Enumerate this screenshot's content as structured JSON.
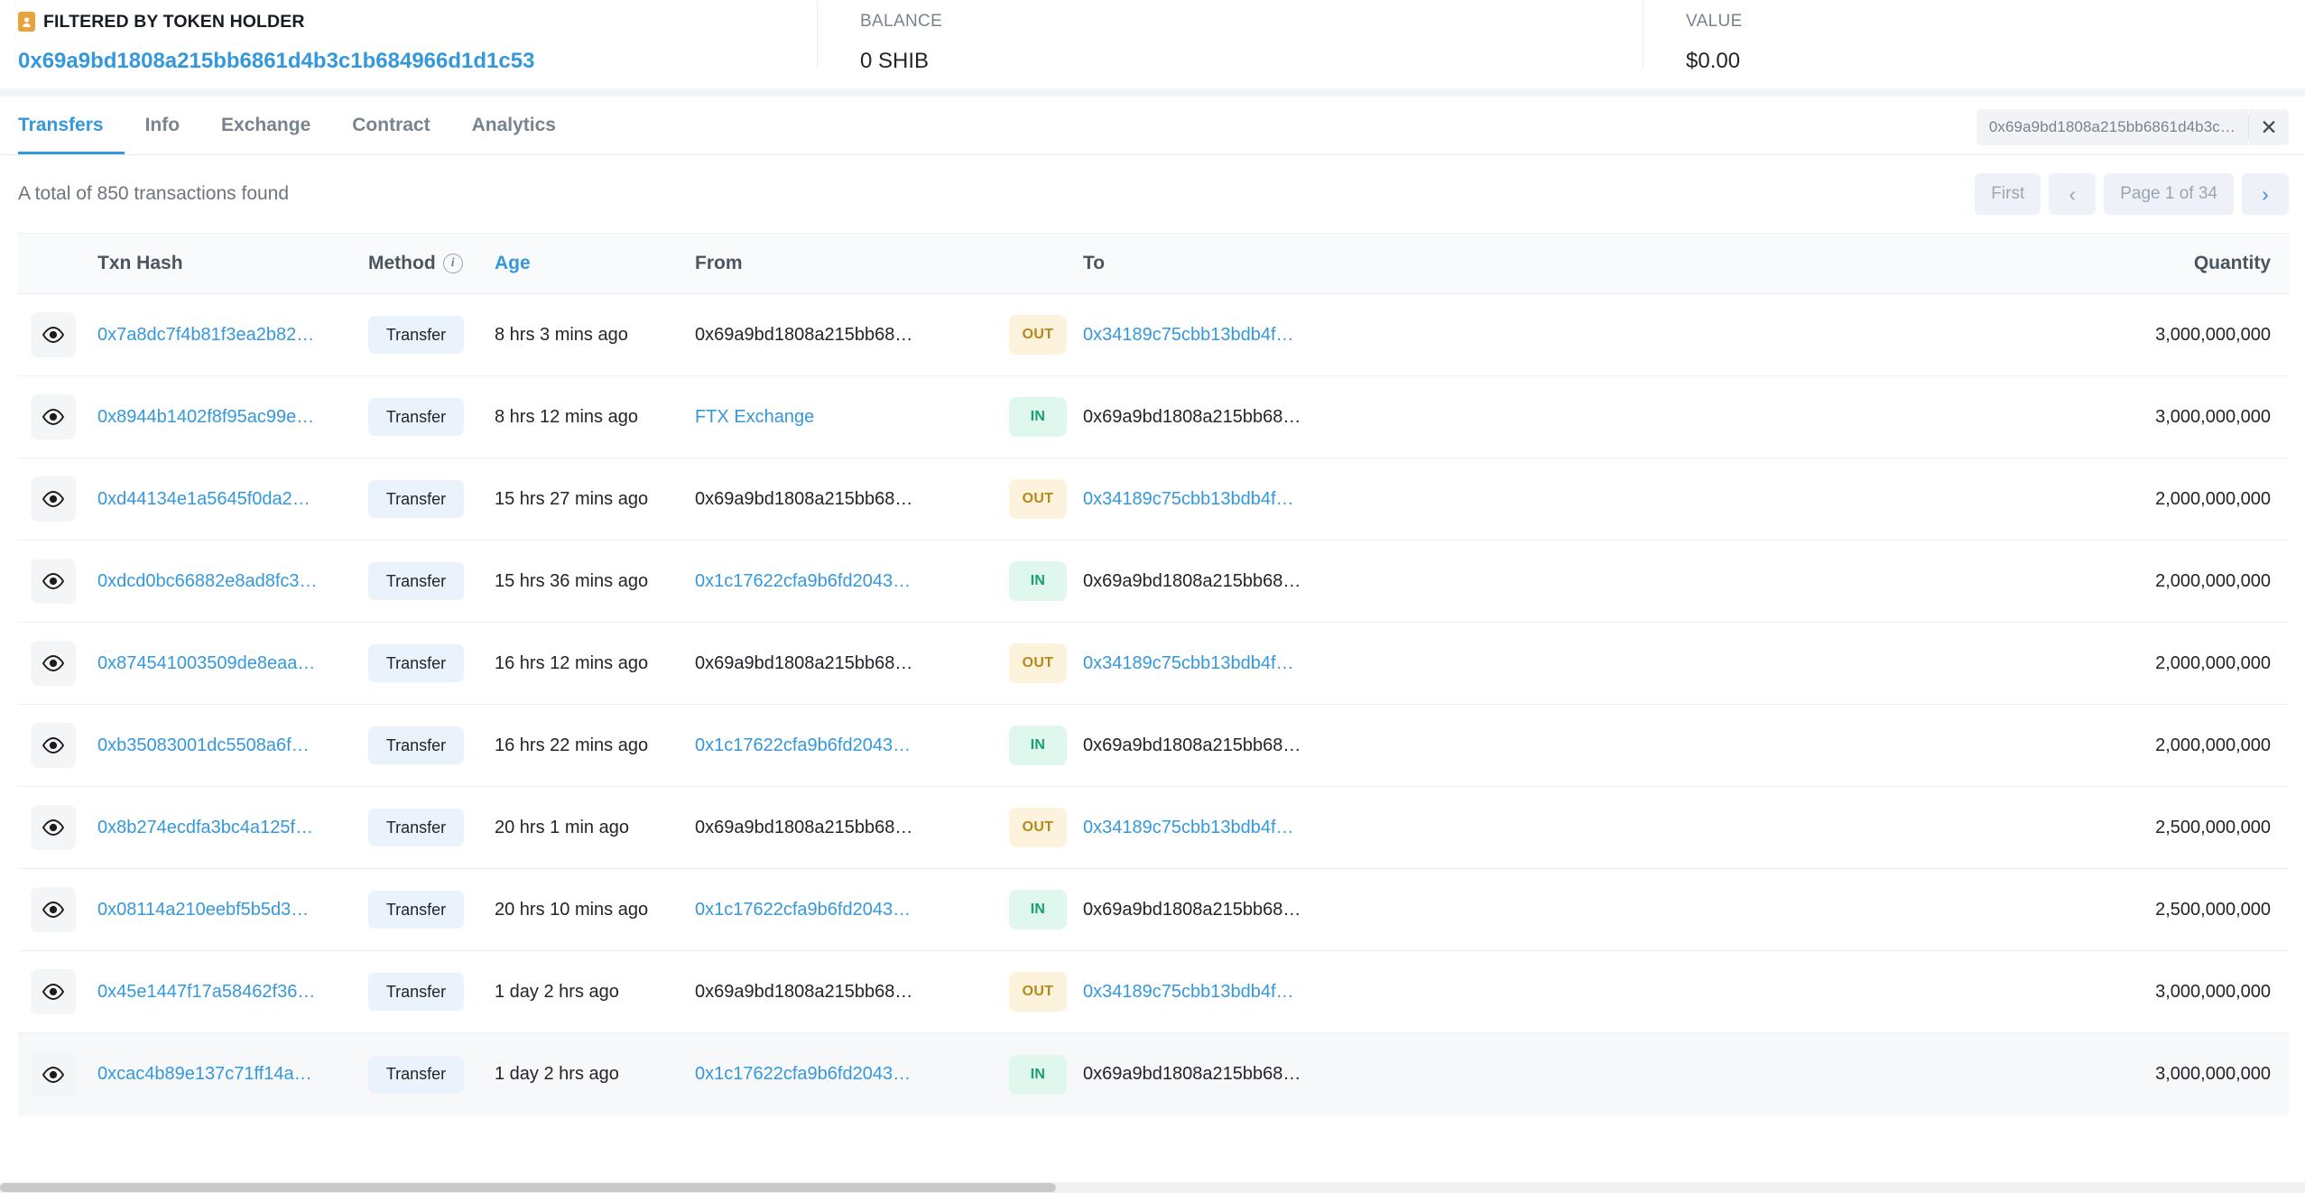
{
  "summary": {
    "filtered_label": "FILTERED BY TOKEN HOLDER",
    "filtered_icon": "token-holder-icon",
    "holder_address": "0x69a9bd1808a215bb6861d4b3c1b684966d1d1c53",
    "balance_label": "BALANCE",
    "balance_value": "0 SHIB",
    "value_label": "VALUE",
    "value_value": "$0.00"
  },
  "tabs": [
    {
      "label": "Transfers",
      "active": true
    },
    {
      "label": "Info",
      "active": false
    },
    {
      "label": "Exchange",
      "active": false
    },
    {
      "label": "Contract",
      "active": false
    },
    {
      "label": "Analytics",
      "active": false
    }
  ],
  "filter": {
    "value": "0x69a9bd1808a215bb6861d4b3c…",
    "clear_icon": "close-icon"
  },
  "results": {
    "count_text": "A total of 850 transactions found",
    "pager": {
      "first": "First",
      "prev": "‹",
      "page": "Page 1 of 34",
      "next": "›"
    }
  },
  "table": {
    "headers": {
      "eye": "",
      "txn_hash": "Txn Hash",
      "method": "Method",
      "method_info_icon": "info-icon",
      "age": "Age",
      "from": "From",
      "dir": "",
      "to": "To",
      "quantity": "Quantity"
    },
    "rows": [
      {
        "hash": "0x7a8dc7f4b81f3ea2b82…",
        "method": "Transfer",
        "age": "8 hrs 3 mins ago",
        "from": "0x69a9bd1808a215bb68…",
        "from_link": false,
        "dir": "OUT",
        "to": "0x34189c75cbb13bdb4f…",
        "to_link": true,
        "qty": "3,000,000,000",
        "hover": false
      },
      {
        "hash": "0x8944b1402f8f95ac99e…",
        "method": "Transfer",
        "age": "8 hrs 12 mins ago",
        "from": "FTX Exchange",
        "from_link": true,
        "dir": "IN",
        "to": "0x69a9bd1808a215bb68…",
        "to_link": false,
        "qty": "3,000,000,000",
        "hover": false
      },
      {
        "hash": "0xd44134e1a5645f0da2…",
        "method": "Transfer",
        "age": "15 hrs 27 mins ago",
        "from": "0x69a9bd1808a215bb68…",
        "from_link": false,
        "dir": "OUT",
        "to": "0x34189c75cbb13bdb4f…",
        "to_link": true,
        "qty": "2,000,000,000",
        "hover": false
      },
      {
        "hash": "0xdcd0bc66882e8ad8fc3…",
        "method": "Transfer",
        "age": "15 hrs 36 mins ago",
        "from": "0x1c17622cfa9b6fd2043…",
        "from_link": true,
        "dir": "IN",
        "to": "0x69a9bd1808a215bb68…",
        "to_link": false,
        "qty": "2,000,000,000",
        "hover": false
      },
      {
        "hash": "0x874541003509de8eaa…",
        "method": "Transfer",
        "age": "16 hrs 12 mins ago",
        "from": "0x69a9bd1808a215bb68…",
        "from_link": false,
        "dir": "OUT",
        "to": "0x34189c75cbb13bdb4f…",
        "to_link": true,
        "qty": "2,000,000,000",
        "hover": false
      },
      {
        "hash": "0xb35083001dc5508a6f…",
        "method": "Transfer",
        "age": "16 hrs 22 mins ago",
        "from": "0x1c17622cfa9b6fd2043…",
        "from_link": true,
        "dir": "IN",
        "to": "0x69a9bd1808a215bb68…",
        "to_link": false,
        "qty": "2,000,000,000",
        "hover": false
      },
      {
        "hash": "0x8b274ecdfa3bc4a125f…",
        "method": "Transfer",
        "age": "20 hrs 1 min ago",
        "from": "0x69a9bd1808a215bb68…",
        "from_link": false,
        "dir": "OUT",
        "to": "0x34189c75cbb13bdb4f…",
        "to_link": true,
        "qty": "2,500,000,000",
        "hover": false
      },
      {
        "hash": "0x08114a210eebf5b5d3…",
        "method": "Transfer",
        "age": "20 hrs 10 mins ago",
        "from": "0x1c17622cfa9b6fd2043…",
        "from_link": true,
        "dir": "IN",
        "to": "0x69a9bd1808a215bb68…",
        "to_link": false,
        "qty": "2,500,000,000",
        "hover": false
      },
      {
        "hash": "0x45e1447f17a58462f36…",
        "method": "Transfer",
        "age": "1 day 2 hrs ago",
        "from": "0x69a9bd1808a215bb68…",
        "from_link": false,
        "dir": "OUT",
        "to": "0x34189c75cbb13bdb4f…",
        "to_link": true,
        "qty": "3,000,000,000",
        "hover": false
      },
      {
        "hash": "0xcac4b89e137c71ff14a…",
        "method": "Transfer",
        "age": "1 day 2 hrs ago",
        "from": "0x1c17622cfa9b6fd2043…",
        "from_link": true,
        "dir": "IN",
        "to": "0x69a9bd1808a215bb68…",
        "to_link": false,
        "qty": "3,000,000,000",
        "hover": true
      }
    ]
  },
  "colors": {
    "link": "#3498db",
    "out_bg": "#fdf3dd",
    "out_fg": "#b5881a",
    "in_bg": "#dff7ec",
    "in_fg": "#1aa06d",
    "method_bg": "#eaf3fb",
    "holder_icon": "#e8a33d"
  }
}
